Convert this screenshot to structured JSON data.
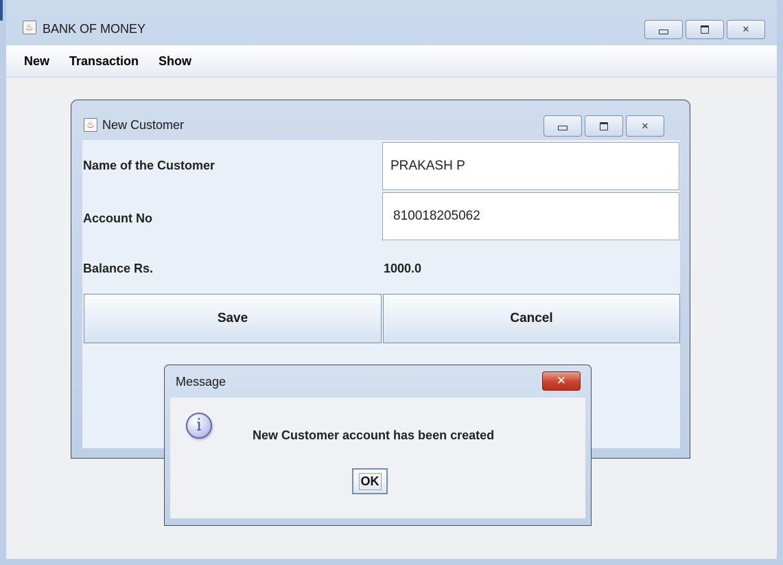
{
  "main_window": {
    "title": "BANK OF MONEY",
    "icon": "java-cup-icon",
    "controls": {
      "minimize": "minimize-icon",
      "maximize": "maximize-icon",
      "close": "close-icon",
      "close_glyph": "✕"
    }
  },
  "menubar": {
    "items": [
      {
        "label": "New"
      },
      {
        "label": "Transaction"
      },
      {
        "label": "Show"
      }
    ]
  },
  "customer_frame": {
    "title": "New Customer",
    "icon": "java-cup-icon",
    "controls": {
      "close_glyph": "✕"
    },
    "form": {
      "name_label": "Name of the Customer",
      "name_value": "PRAKASH P",
      "account_label": "Account No",
      "account_value": "810018205062",
      "balance_label": "Balance Rs.",
      "balance_value": "1000.0",
      "save_label": "Save",
      "cancel_label": "Cancel"
    }
  },
  "message_dialog": {
    "title": "Message",
    "close_glyph": "✕",
    "icon": "info-icon",
    "icon_glyph": "i",
    "message": "New Customer account has been created",
    "ok_label": "OK"
  },
  "colors": {
    "title_bar": "#c5d6ea",
    "close_button_red": "#c8442c",
    "content_background": "#eff0f2"
  }
}
